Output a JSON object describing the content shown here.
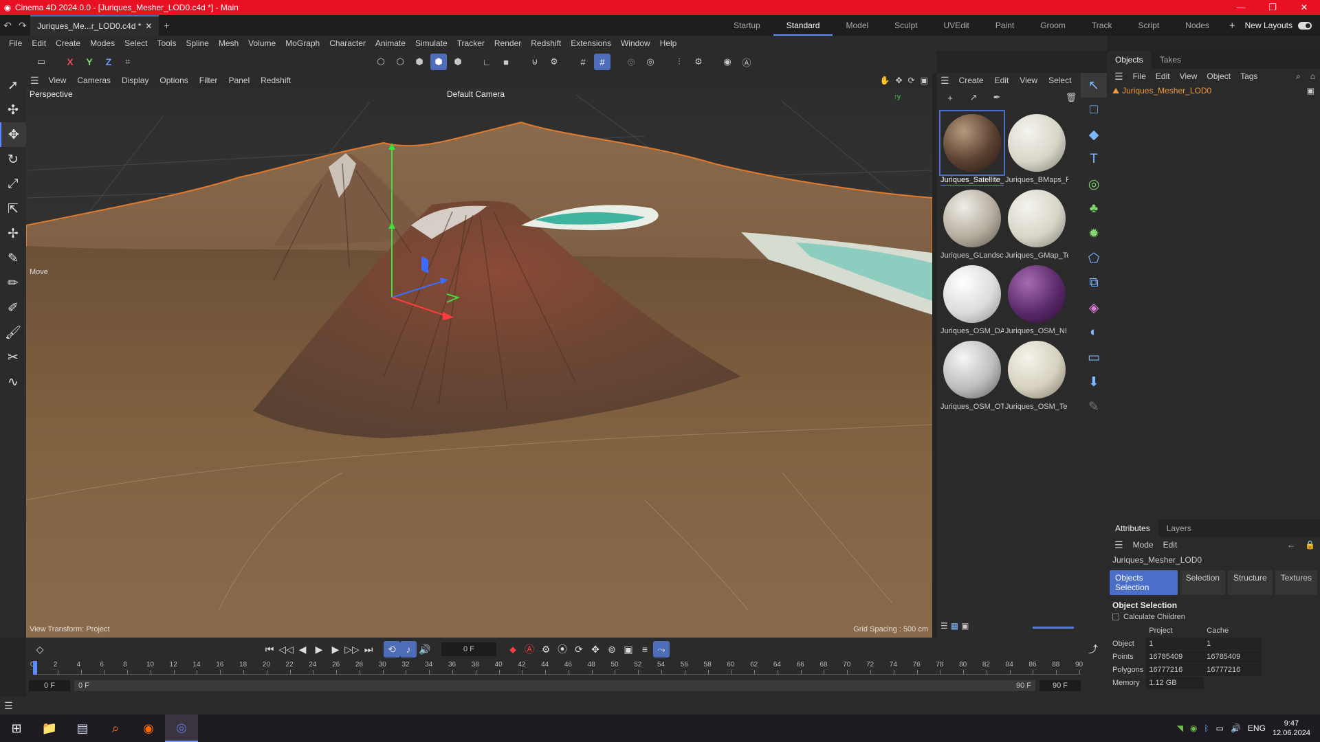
{
  "window": {
    "title": "Cinema 4D 2024.0.0 - [Juriques_Mesher_LOD0.c4d *] - Main",
    "controls": [
      "—",
      "❐",
      "✕"
    ]
  },
  "tabs": {
    "doc": "Juriques_Me...r_LOD0.c4d *",
    "add": "+"
  },
  "layouts": {
    "items": [
      "Startup",
      "Standard",
      "Model",
      "Sculpt",
      "UVEdit",
      "Paint",
      "Groom",
      "Track",
      "Script",
      "Nodes"
    ],
    "active": "Standard",
    "new_layouts": "New Layouts"
  },
  "menu": [
    "File",
    "Edit",
    "Create",
    "Modes",
    "Select",
    "Tools",
    "Spline",
    "Mesh",
    "Volume",
    "MoGraph",
    "Character",
    "Animate",
    "Simulate",
    "Tracker",
    "Render",
    "Redshift",
    "Extensions",
    "Window",
    "Help"
  ],
  "axis": {
    "x": "X",
    "y": "Y",
    "z": "Z"
  },
  "viewport": {
    "menu": [
      "View",
      "Cameras",
      "Display",
      "Options",
      "Filter",
      "Panel",
      "Redshift"
    ],
    "label": "Perspective",
    "camera": "Default Camera",
    "move": "Move",
    "view_transform": "View Transform: Project",
    "grid_spacing": "Grid Spacing : 500 cm"
  },
  "materials": {
    "menu": [
      "Create",
      "Edit",
      "View",
      "Select"
    ],
    "items": [
      {
        "name": "Juriques_Satellite_",
        "colors": [
          "#b69a7e",
          "#5a4030",
          "#241810"
        ],
        "selected": true
      },
      {
        "name": "Juriques_BMaps_F",
        "colors": [
          "#f4f3ee",
          "#d8d6c8",
          "#7c7a70"
        ],
        "selected": false
      },
      {
        "name": "Juriques_GLandsc",
        "colors": [
          "#f0ede6",
          "#b5ad9f",
          "#5a554c"
        ],
        "selected": false
      },
      {
        "name": "Juriques_GMap_Te",
        "colors": [
          "#f4f3ee",
          "#d8d6c8",
          "#7c7a70"
        ],
        "selected": false
      },
      {
        "name": "Juriques_OSM_DA",
        "colors": [
          "#ffffff",
          "#dcdcdc",
          "#8a8a8a"
        ],
        "selected": false
      },
      {
        "name": "Juriques_OSM_NI",
        "colors": [
          "#a66cb0",
          "#5a2a6a",
          "#2a0e32"
        ],
        "selected": false
      },
      {
        "name": "Juriques_OSM_OT",
        "colors": [
          "#f6f6f6",
          "#bdbdbd",
          "#5a5a5a"
        ],
        "selected": false
      },
      {
        "name": "Juriques_OSM_Te",
        "colors": [
          "#f5f3ea",
          "#d6d1bf",
          "#7a7564"
        ],
        "selected": false
      }
    ]
  },
  "objects": {
    "tabs": [
      "Objects",
      "Takes"
    ],
    "menu": [
      "File",
      "Edit",
      "View",
      "Object",
      "Tags"
    ],
    "items": [
      "Juriques_Mesher_LOD0"
    ]
  },
  "attributes": {
    "tabs": [
      "Attributes",
      "Layers"
    ],
    "menu": [
      "Mode",
      "Edit"
    ],
    "object_name": "Juriques_Mesher_LOD0",
    "buttons": [
      "Objects Selection",
      "Selection",
      "Structure",
      "Textures"
    ],
    "section": "Object Selection",
    "calc_children": "Calculate Children",
    "col_project": "Project",
    "col_cache": "Cache",
    "rows": [
      {
        "label": "Object",
        "project": "1",
        "cache": "1"
      },
      {
        "label": "Points",
        "project": "16785409",
        "cache": "16785409"
      },
      {
        "label": "Polygons",
        "project": "16777216",
        "cache": "16777216"
      },
      {
        "label": "Memory",
        "project": "1.12 GB",
        "cache": ""
      }
    ]
  },
  "timeline": {
    "current_frame": "0 F",
    "ticks": [
      "0",
      "2",
      "4",
      "6",
      "8",
      "10",
      "12",
      "14",
      "16",
      "18",
      "20",
      "22",
      "24",
      "26",
      "28",
      "30",
      "32",
      "34",
      "36",
      "38",
      "40",
      "42",
      "44",
      "46",
      "48",
      "50",
      "52",
      "54",
      "56",
      "58",
      "60",
      "62",
      "64",
      "66",
      "68",
      "70",
      "72",
      "74",
      "76",
      "78",
      "80",
      "82",
      "84",
      "86",
      "88",
      "90"
    ],
    "start": "0 F",
    "range_start": "0 F",
    "range_end": "90 F",
    "end": "90 F"
  },
  "taskbar": {
    "lang": "ENG",
    "time": "9:47",
    "date": "12.06.2024"
  },
  "colors": {
    "titlebar": "#e81123",
    "accent": "#4d6db8",
    "object_orange": "#f09a3e"
  }
}
